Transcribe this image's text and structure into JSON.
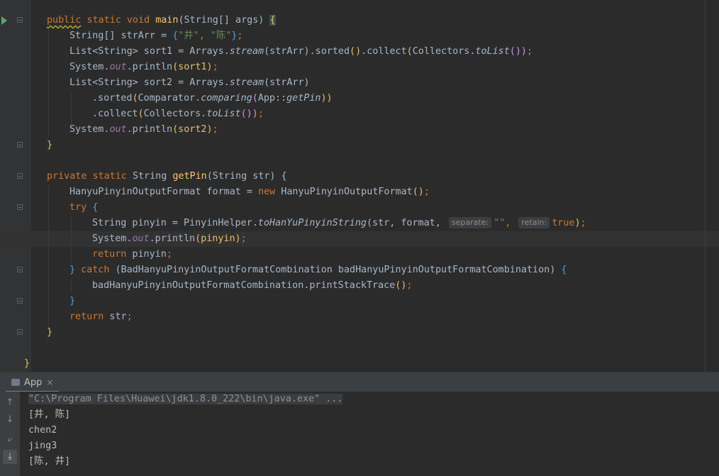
{
  "editor": {
    "lines": {
      "l1": {
        "kw1": "public",
        "kw2": "static",
        "kw3": "void",
        "fn": "main",
        "rest": "(String[] args) ",
        "brace": "{"
      },
      "l2": {
        "a": "String[] strArr = ",
        "open": "{",
        "s1": "\"井\"",
        "comma": ", ",
        "s2": "\"陈\"",
        "close": "}",
        "end": ";"
      },
      "l3": {
        "a": "List<String> sort1 = Arrays.",
        "m": "stream",
        "b": "(strArr).sorted",
        "p1": "()",
        "c": ".collect",
        "p2": "(",
        "d": "Collectors.",
        "m2": "toList",
        "p3": "())",
        "end": ";"
      },
      "l4": {
        "a": "System.",
        "f": "out",
        "b": ".println",
        "p": "(sort1)",
        "end": ";"
      },
      "l5": {
        "a": "List<String> sort2 = Arrays.",
        "m": "stream",
        "b": "(strArr)"
      },
      "l6": {
        "a": ".sorted",
        "p1": "(",
        "b": "Comparator.",
        "m": "comparing",
        "p2": "(",
        "c": "App::",
        "m2": "getPin",
        "p3": "))"
      },
      "l7": {
        "a": ".collect",
        "p1": "(",
        "b": "Collectors.",
        "m": "toList",
        "p2": "())",
        "end": ";"
      },
      "l8": {
        "a": "System.",
        "f": "out",
        "b": ".println",
        "p": "(sort2)",
        "end": ";"
      },
      "l9": {
        "a": "}"
      },
      "l11": {
        "kw1": "private",
        "kw2": "static",
        "a": "String ",
        "fn": "getPin",
        "b": "(String str) {"
      },
      "l12": {
        "a": "HanyuPinyinOutputFormat format = ",
        "kw": "new",
        "b": " HanyuPinyinOutputFormat",
        "p": "()",
        "end": ";"
      },
      "l13": {
        "kw": "try",
        "brace": "{"
      },
      "l14": {
        "a": "String pinyin = PinyinHelper.",
        "m": "toHanYuPinyinString",
        "b": "(str, format,",
        "hint1": "separate:",
        "s": "\"\"",
        "c": ",",
        "hint2": "retain:",
        "kw": "true",
        "d": ")",
        "end": ";"
      },
      "l15": {
        "a": "System.",
        "f": "out",
        "b": ".println",
        "p": "(pinyin)",
        "end": ";"
      },
      "l16": {
        "kw": "return",
        "b": " pinyin",
        "end": ";"
      },
      "l17": {
        "br": "}",
        "kw": "catch",
        "b": " (BadHanyuPinyinOutputFormatCombination badHanyuPinyinOutputFormatCombination) ",
        "br2": "{"
      },
      "l18": {
        "a": "badHanyuPinyinOutputFormatCombination.printStackTrace",
        "p": "()",
        "end": ";"
      },
      "l19": {
        "br": "}"
      },
      "l20": {
        "kw": "return",
        "b": " str",
        "end": ";"
      },
      "l21": {
        "a": "}"
      },
      "l23": {
        "a": "}"
      }
    }
  },
  "run_panel": {
    "tab_label": "App",
    "close_glyph": "×",
    "output": [
      "\"C:\\Program Files\\Huawei\\jdk1.8.0_222\\bin\\java.exe\" ...",
      "[井, 陈]",
      "chen2",
      "jing3",
      "[陈, 井]"
    ],
    "toolbar_icons": [
      "arrow-up-icon",
      "arrow-down-icon",
      "soft-wrap-icon",
      "scroll-to-end-icon"
    ]
  }
}
